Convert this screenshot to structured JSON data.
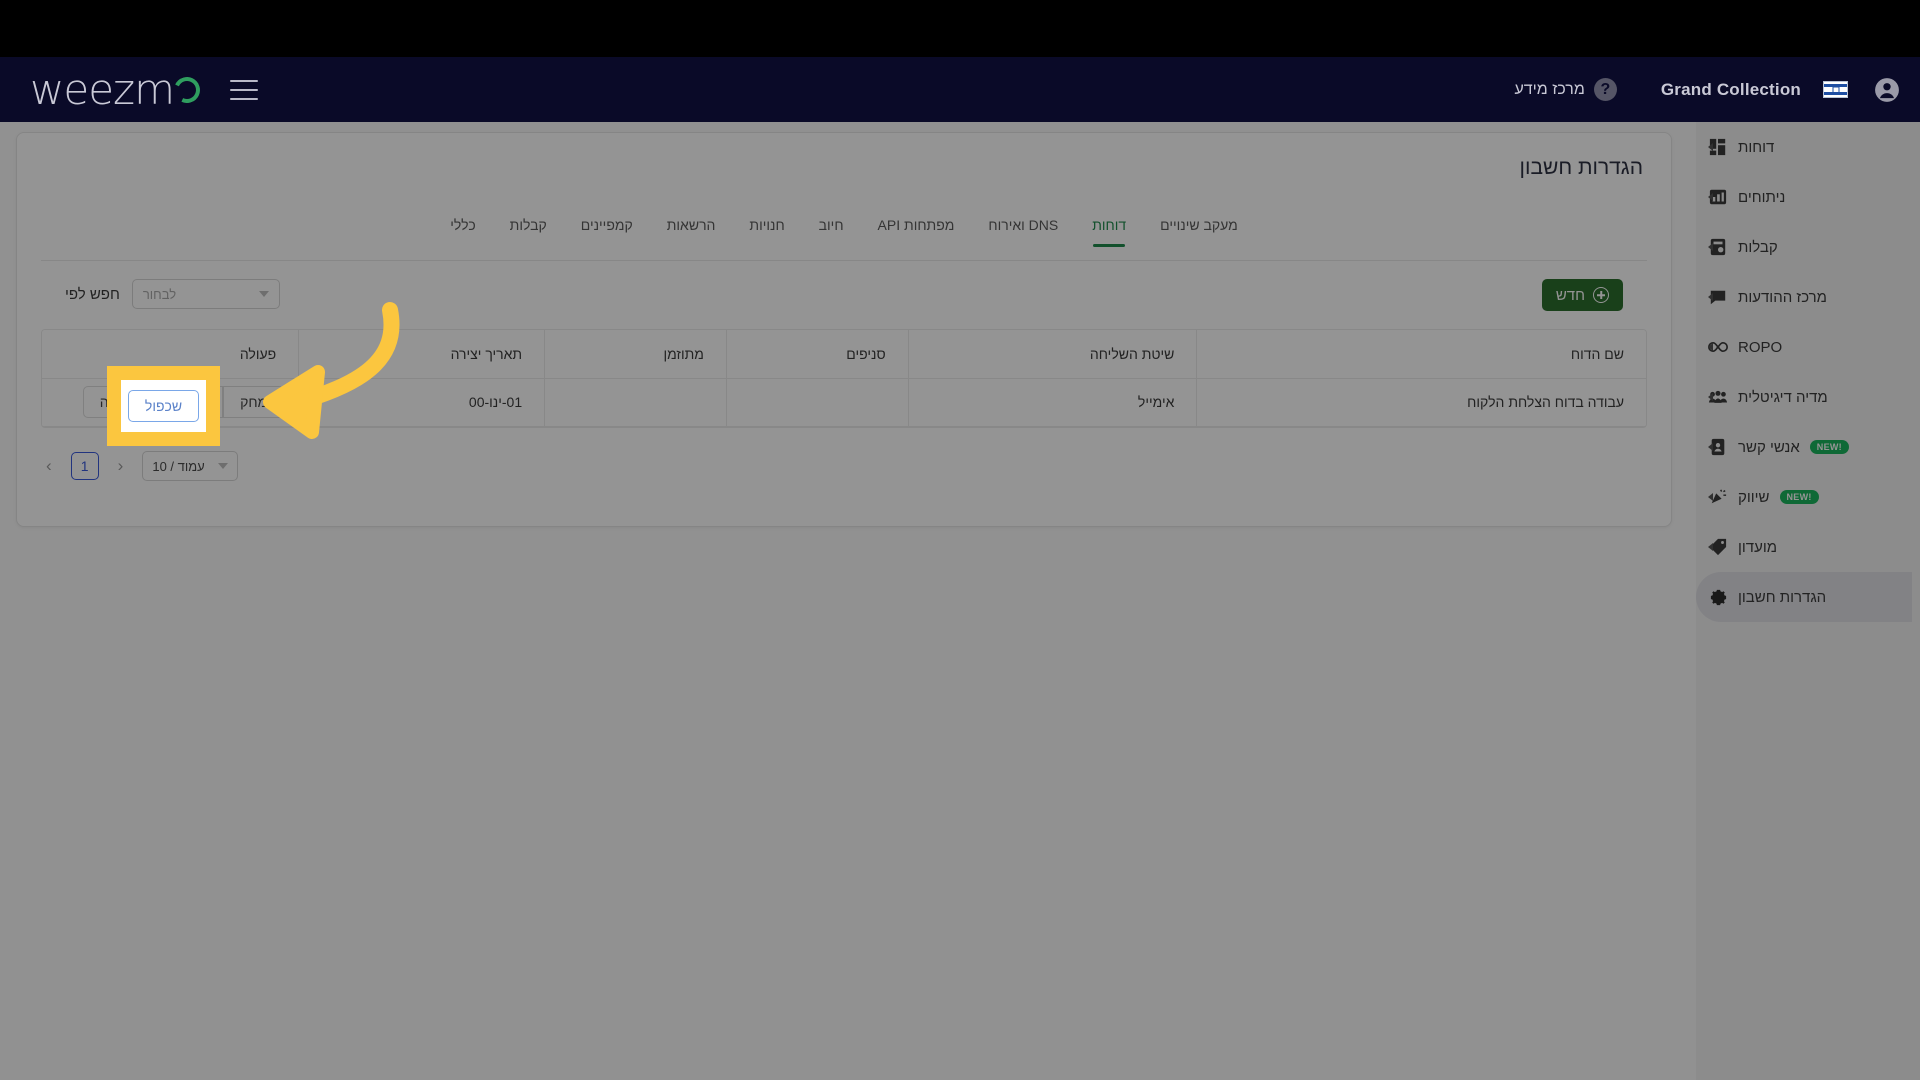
{
  "topbar": {
    "avatar_icon": "account-circle-icon",
    "flag_icon": "israel-flag-icon",
    "brand": "Grand Collection",
    "help_icon": "question-mark-icon",
    "help_label": "מרכז מידע",
    "menu_icon": "hamburger-icon",
    "logo": "weezm"
  },
  "sidemenu": {
    "items": [
      {
        "label": "דוחות",
        "icon": "dashboard-grid-icon",
        "badge": "",
        "active": false
      },
      {
        "label": "ניתוחים",
        "icon": "bar-chart-icon",
        "badge": "",
        "active": false
      },
      {
        "label": "קבלות",
        "icon": "receipt-icon",
        "badge": "",
        "active": false
      },
      {
        "label": "מרכז ההודעות",
        "icon": "message-icon",
        "badge": "",
        "active": false
      },
      {
        "label": "ROPO",
        "icon": "infinity-icon",
        "badge": "",
        "active": false
      },
      {
        "label": "מדיה דיגיטלית",
        "icon": "people-group-icon",
        "badge": "",
        "active": false
      },
      {
        "label": "אנשי קשר",
        "icon": "contact-card-icon",
        "badge": "NEW!",
        "active": false
      },
      {
        "label": "שיווק",
        "icon": "megaphone-icon",
        "badge": "NEW!",
        "active": false
      },
      {
        "label": "מועדון",
        "icon": "tag-icon",
        "badge": "",
        "active": false
      },
      {
        "label": "הגדרות חשבון",
        "icon": "gear-icon",
        "badge": "",
        "active": true
      }
    ]
  },
  "page": {
    "title": "הגדרות חשבון"
  },
  "tabs": [
    {
      "label": "מעקב שינויים",
      "active": false
    },
    {
      "label": "דוחות",
      "active": true
    },
    {
      "label": "DNS ואירוח",
      "active": false
    },
    {
      "label": "מפתחות API",
      "active": false
    },
    {
      "label": "חיוב",
      "active": false
    },
    {
      "label": "חנויות",
      "active": false
    },
    {
      "label": "הרשאות",
      "active": false
    },
    {
      "label": "קמפיינים",
      "active": false
    },
    {
      "label": "קבלות",
      "active": false
    },
    {
      "label": "כללי",
      "active": false
    }
  ],
  "toolbar": {
    "new_label": "חדש",
    "new_icon": "plus-circle-icon",
    "filter_label": "חפש לפי",
    "filter_placeholder": "לבחור",
    "filter_value": "",
    "filter_chevron_icon": "chevron-down-icon"
  },
  "table": {
    "headers": [
      "שם הדוח",
      "שיטת השליחה",
      "סניפים",
      "מתוזמן",
      "תאריך יצירה",
      "פעולה"
    ],
    "rows": [
      {
        "name": "עבודה בדוח הצלחת הלקוח",
        "method": "אימייל",
        "branches": "",
        "scheduled": "",
        "created": "01-ינו-00",
        "actions": [
          "מחק",
          "שכפול",
          "עריכה"
        ]
      }
    ]
  },
  "pagination": {
    "per_page": "עמוד / 10",
    "per_page_chevron_icon": "chevron-down-icon",
    "prev_icon": "chevron-left-icon",
    "next_icon": "chevron-right-icon",
    "current_page": "1"
  },
  "annotation": {
    "highlight_target": "שכפול",
    "arrow_icon": "curved-arrow-icon",
    "accent_color": "#fbc63f"
  },
  "colors": {
    "topbar_bg": "#0a0a28",
    "brand_green": "#1f8b4d",
    "new_button_green": "#2c6e2e",
    "badge_green": "#1bb65e",
    "selected_blue": "#5b82c9",
    "page_blue": "#3b5bdb"
  }
}
